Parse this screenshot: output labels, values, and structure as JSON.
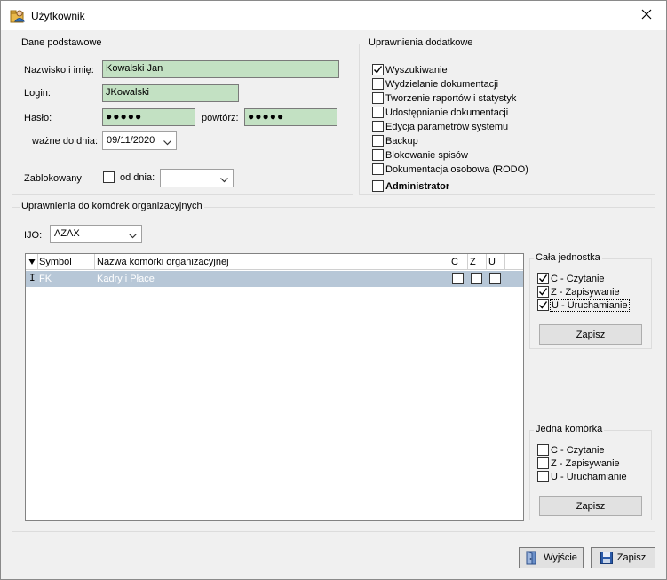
{
  "window": {
    "title": "Użytkownik",
    "icon": "user-folder-icon",
    "close_icon": "close-icon"
  },
  "basic": {
    "legend": "Dane podstawowe",
    "name_label": "Nazwisko i imię:",
    "name_value": "Kowalski Jan",
    "login_label": "Login:",
    "login_value": "JKowalski",
    "password_label": "Hasło:",
    "password_value": "●●●●●",
    "repeat_label": "powtórz:",
    "repeat_value": "●●●●●",
    "valid_label": "ważne do dnia:",
    "valid_value": "09/11/2020",
    "blocked_label": "Zablokowany",
    "blocked_checked": false,
    "from_label": "od dnia:",
    "from_value": ""
  },
  "extra": {
    "legend": "Uprawnienia dodatkowe",
    "items": [
      {
        "label": "Wyszukiwanie",
        "checked": true
      },
      {
        "label": "Wydzielanie dokumentacji",
        "checked": false
      },
      {
        "label": "Tworzenie raportów i statystyk",
        "checked": false
      },
      {
        "label": "Udostępnianie dokumentacji",
        "checked": false
      },
      {
        "label": "Edycja parametrów systemu",
        "checked": false
      },
      {
        "label": "Backup",
        "checked": false
      },
      {
        "label": "Blokowanie spisów",
        "checked": false
      },
      {
        "label": "Dokumentacja osobowa (RODO)",
        "checked": false
      },
      {
        "label": "Administrator",
        "checked": false
      }
    ]
  },
  "org": {
    "legend": "Uprawnienia do komórek organizacyjnych",
    "ijo_label": "IJO:",
    "ijo_value": "AZAX",
    "grid": {
      "sort_icon": "sort-down-icon",
      "col_symbol": "Symbol",
      "col_name": "Nazwa komórki organizacyjnej",
      "col_c": "C",
      "col_z": "Z",
      "col_u": "U",
      "row_marker": "I",
      "rows": [
        {
          "symbol": "FK",
          "name": "Kadry i Płace",
          "c": false,
          "z": false,
          "u": false
        }
      ]
    },
    "whole_unit": {
      "legend": "Cała jednostka",
      "c_label": "C - Czytanie",
      "c_checked": true,
      "z_label": "Z - Zapisywanie",
      "z_checked": true,
      "u_label": "U - Uruchamianie",
      "u_checked": true,
      "save_label": "Zapisz"
    },
    "single_cell": {
      "legend": "Jedna komórka",
      "c_label": "C - Czytanie",
      "c_checked": false,
      "z_label": "Z - Zapisywanie",
      "z_checked": false,
      "u_label": "U - Uruchamianie",
      "u_checked": false,
      "save_label": "Zapisz"
    }
  },
  "footer": {
    "exit_label": "Wyjście",
    "exit_icon": "exit-door-icon",
    "save_label": "Zapisz",
    "save_icon": "floppy-disk-icon"
  },
  "colors": {
    "window_bg": "#f0f0f0",
    "field_green": "#c3e1c3",
    "selected_row": "#b7c7d7",
    "button_bg": "#e1e1e1"
  }
}
